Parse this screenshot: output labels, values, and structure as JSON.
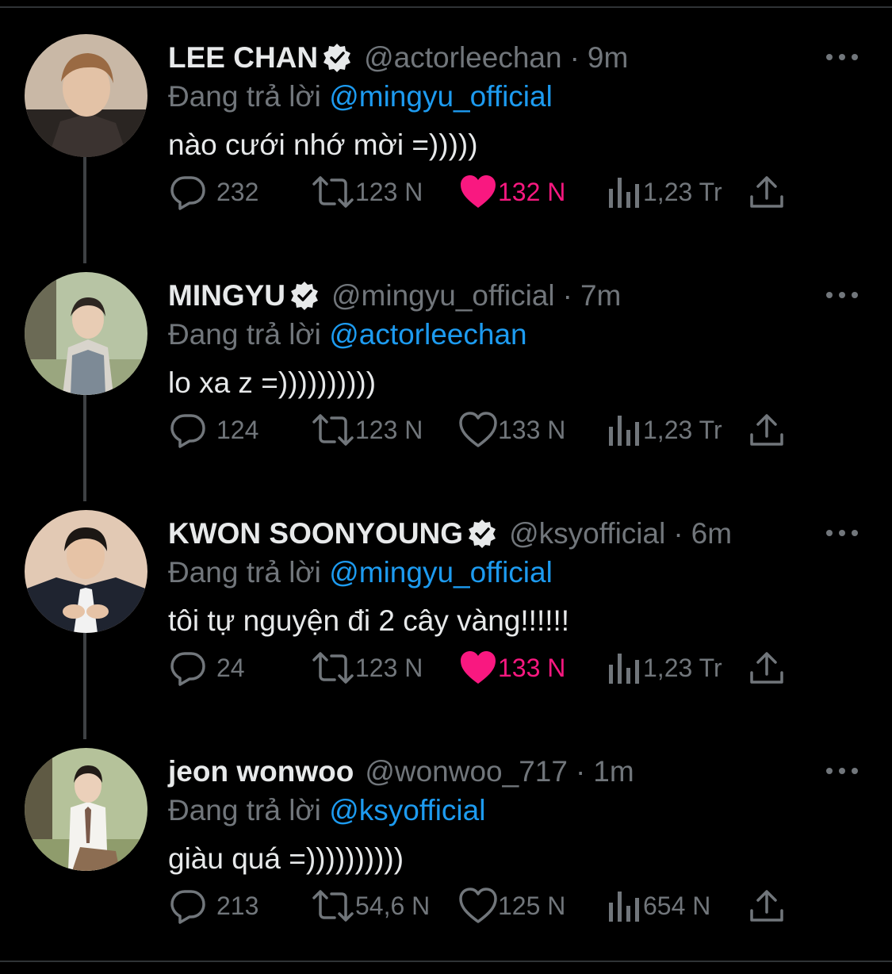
{
  "reply_prefix": "Đang trả lời",
  "tweets": [
    {
      "name": "LEE CHAN",
      "handle": "@actorleechan",
      "time": "9m",
      "reply_to": "@mingyu_official",
      "text": "nào cưới nhớ mời =)))))",
      "replies": "232",
      "retweets": "123 N",
      "likes": "132 N",
      "liked": true,
      "views": "1,23 Tr"
    },
    {
      "name": "MINGYU",
      "handle": "@mingyu_official",
      "time": "7m",
      "reply_to": "@actorleechan",
      "text": "lo xa z =))))))))))",
      "replies": "124",
      "retweets": "123 N",
      "likes": "133 N",
      "liked": false,
      "views": "1,23 Tr"
    },
    {
      "name": "KWON SOONYOUNG",
      "handle": "@ksyofficial",
      "time": "6m",
      "reply_to": "@mingyu_official",
      "text": "tôi tự nguyện đi 2 cây vàng!!!!!!",
      "replies": "24",
      "retweets": "123 N",
      "likes": "133 N",
      "liked": true,
      "views": "1,23 Tr"
    },
    {
      "name": "jeon wonwoo",
      "handle": "@wonwoo_717",
      "time": "1m",
      "reply_to": "@ksyofficial",
      "text": "giàu quá =))))))))))",
      "replies": "213",
      "retweets": "54,6 N",
      "likes": "125 N",
      "liked": false,
      "views": "654 N"
    }
  ],
  "colors": {
    "background": "#000000",
    "text": "#e7e9ea",
    "muted": "#71767b",
    "link": "#1d9bf0",
    "like": "#f91880"
  }
}
